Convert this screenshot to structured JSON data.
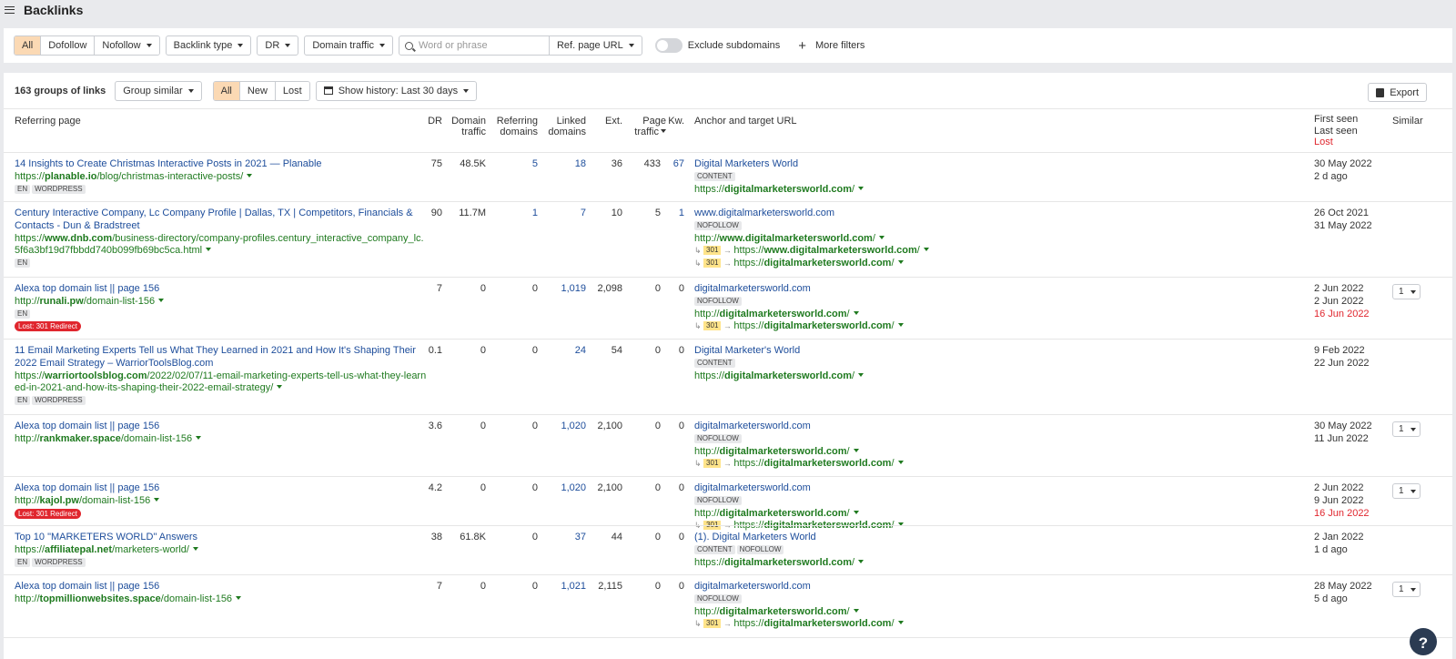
{
  "header": {
    "title": "Backlinks"
  },
  "filters": {
    "link_types": [
      "All",
      "Dofollow"
    ],
    "nofollow": "Nofollow",
    "backlink_type": "Backlink type",
    "dr": "DR",
    "domain_traffic": "Domain traffic",
    "search_placeholder": "Word or phrase",
    "search_scope": "Ref. page URL",
    "exclude_subdomains": "Exclude subdomains",
    "more_filters": "More filters"
  },
  "controls": {
    "count": "163 groups of links",
    "group": "Group similar",
    "status": [
      "All",
      "New",
      "Lost"
    ],
    "history": "Show history: Last 30 days",
    "export": "Export"
  },
  "columns": {
    "referring_page": "Referring page",
    "dr": "DR",
    "domain_traffic_1": "Domain",
    "domain_traffic_2": "traffic",
    "ref_domains_1": "Referring",
    "ref_domains_2": "domains",
    "linked_domains_1": "Linked",
    "linked_domains_2": "domains",
    "ext": "Ext.",
    "page_traffic_1": "Page",
    "page_traffic_2": "traffic",
    "kw": "Kw.",
    "anchor": "Anchor and target URL",
    "first_seen": "First seen",
    "last_seen": "Last seen",
    "lost": "Lost",
    "similar": "Similar"
  },
  "rows": [
    {
      "title": [
        "14 Insights to Create Christmas Interactive Posts in 2021 — Planable"
      ],
      "url": [
        {
          "pre": "https://",
          "bold": "planable.io",
          "post": "/blog/christmas-interactive-posts/"
        }
      ],
      "tags": [
        "EN",
        "WORDPRESS"
      ],
      "lost_badge": "",
      "dr": "75",
      "dt": "48.5K",
      "rd": "5",
      "ld": "18",
      "ext": "36",
      "pt": "433",
      "kw": "67",
      "anchor": "Digital Marketers World",
      "anchor_tags": [
        "CONTENT"
      ],
      "targets": [
        {
          "pre": "https://",
          "bold": "digitalmarketersworld.com",
          "post": "/"
        }
      ],
      "redirects": [],
      "first": "30 May 2022",
      "last": "2 d ago",
      "lost": "",
      "similar": ""
    },
    {
      "title": [
        "Century Interactive Company, Lc Company Profile | Dallas, TX | Competitors, Financials &",
        "Contacts - Dun & Bradstreet"
      ],
      "url": [
        {
          "pre": "https://",
          "bold": "www.dnb.com",
          "post": "/business-directory/company-profiles.century_interactive_company_lc."
        },
        {
          "pre": "",
          "bold": "",
          "post": "5f6a3bf19d7fbbdd740b099fb69bc5ca.html"
        }
      ],
      "tags": [
        "EN"
      ],
      "lost_badge": "",
      "dr": "90",
      "dt": "11.7M",
      "rd": "1",
      "ld": "7",
      "ext": "10",
      "pt": "5",
      "kw": "1",
      "anchor": "www.digitalmarketersworld.com",
      "anchor_tags": [
        "NOFOLLOW"
      ],
      "targets": [
        {
          "pre": "http://",
          "bold": "www.digitalmarketersworld.com",
          "post": "/"
        }
      ],
      "redirects": [
        {
          "code": "301",
          "pre": "https://",
          "bold": "www.digitalmarketersworld.com",
          "post": "/"
        },
        {
          "code": "301",
          "pre": "https://",
          "bold": "digitalmarketersworld.com",
          "post": "/"
        }
      ],
      "first": "26 Oct 2021",
      "last": "31 May 2022",
      "lost": "",
      "similar": ""
    },
    {
      "title": [
        "Alexa top domain list || page 156"
      ],
      "url": [
        {
          "pre": "http://",
          "bold": "runali.pw",
          "post": "/domain-list-156"
        }
      ],
      "tags": [
        "EN"
      ],
      "lost_badge": "Lost: 301 Redirect",
      "dr": "7",
      "dt": "0",
      "rd": "0",
      "ld": "1,019",
      "ext": "2,098",
      "pt": "0",
      "kw": "0",
      "anchor": "digitalmarketersworld.com",
      "anchor_tags": [
        "NOFOLLOW"
      ],
      "targets": [
        {
          "pre": "http://",
          "bold": "digitalmarketersworld.com",
          "post": "/"
        }
      ],
      "redirects": [
        {
          "code": "301",
          "pre": "https://",
          "bold": "digitalmarketersworld.com",
          "post": "/"
        }
      ],
      "first": "2 Jun 2022",
      "last": "2 Jun 2022",
      "lost": "16 Jun 2022",
      "similar": "1"
    },
    {
      "title": [
        "11 Email Marketing Experts Tell us What They Learned in 2021 and How It's Shaping Their",
        "2022 Email Strategy – WarriorToolsBlog.com"
      ],
      "url": [
        {
          "pre": "https://",
          "bold": "warriortoolsblog.com",
          "post": "/2022/02/07/11-email-marketing-experts-tell-us-what-they-learn"
        },
        {
          "pre": "",
          "bold": "",
          "post": "ed-in-2021-and-how-its-shaping-their-2022-email-strategy/"
        }
      ],
      "tags": [
        "EN",
        "WORDPRESS"
      ],
      "lost_badge": "",
      "dr": "0.1",
      "dt": "0",
      "rd": "0",
      "ld": "24",
      "ext": "54",
      "pt": "0",
      "kw": "0",
      "anchor": "Digital Marketer's World",
      "anchor_tags": [
        "CONTENT"
      ],
      "targets": [
        {
          "pre": "https://",
          "bold": "digitalmarketersworld.com",
          "post": "/"
        }
      ],
      "redirects": [],
      "first": "9 Feb 2022",
      "last": "22 Jun 2022",
      "lost": "",
      "similar": ""
    },
    {
      "title": [
        "Alexa top domain list || page 156"
      ],
      "url": [
        {
          "pre": "http://",
          "bold": "rankmaker.space",
          "post": "/domain-list-156"
        }
      ],
      "tags": [],
      "lost_badge": "",
      "dr": "3.6",
      "dt": "0",
      "rd": "0",
      "ld": "1,020",
      "ext": "2,100",
      "pt": "0",
      "kw": "0",
      "anchor": "digitalmarketersworld.com",
      "anchor_tags": [
        "NOFOLLOW"
      ],
      "targets": [
        {
          "pre": "http://",
          "bold": "digitalmarketersworld.com",
          "post": "/"
        }
      ],
      "redirects": [
        {
          "code": "301",
          "pre": "https://",
          "bold": "digitalmarketersworld.com",
          "post": "/"
        }
      ],
      "first": "30 May 2022",
      "last": "11 Jun 2022",
      "lost": "",
      "similar": "1"
    },
    {
      "title": [
        "Alexa top domain list || page 156"
      ],
      "url": [
        {
          "pre": "http://",
          "bold": "kajol.pw",
          "post": "/domain-list-156"
        }
      ],
      "tags": [],
      "lost_badge": "Lost: 301 Redirect",
      "dr": "4.2",
      "dt": "0",
      "rd": "0",
      "ld": "1,020",
      "ext": "2,100",
      "pt": "0",
      "kw": "0",
      "anchor": "digitalmarketersworld.com",
      "anchor_tags": [
        "NOFOLLOW"
      ],
      "targets": [
        {
          "pre": "http://",
          "bold": "digitalmarketersworld.com",
          "post": "/"
        }
      ],
      "redirects": [
        {
          "code": "301",
          "pre": "https://",
          "bold": "digitalmarketersworld.com",
          "post": "/"
        }
      ],
      "first": "2 Jun 2022",
      "last": "9 Jun 2022",
      "lost": "16 Jun 2022",
      "similar": "1"
    },
    {
      "title": [
        "Top 10 \"MARKETERS WORLD\" Answers"
      ],
      "url": [
        {
          "pre": "https://",
          "bold": "affiliatepal.net",
          "post": "/marketers-world/"
        }
      ],
      "tags": [
        "EN",
        "WORDPRESS"
      ],
      "lost_badge": "",
      "dr": "38",
      "dt": "61.8K",
      "rd": "0",
      "ld": "37",
      "ext": "44",
      "pt": "0",
      "kw": "0",
      "anchor": "(1). Digital Marketers World",
      "anchor_tags": [
        "CONTENT",
        "NOFOLLOW"
      ],
      "targets": [
        {
          "pre": "https://",
          "bold": "digitalmarketersworld.com",
          "post": "/"
        }
      ],
      "redirects": [],
      "first": "2 Jan 2022",
      "last": "1 d ago",
      "lost": "",
      "similar": ""
    },
    {
      "title": [
        "Alexa top domain list || page 156"
      ],
      "url": [
        {
          "pre": "http://",
          "bold": "topmillionwebsites.space",
          "post": "/domain-list-156"
        }
      ],
      "tags": [],
      "lost_badge": "",
      "dr": "7",
      "dt": "0",
      "rd": "0",
      "ld": "1,021",
      "ext": "2,115",
      "pt": "0",
      "kw": "0",
      "anchor": "digitalmarketersworld.com",
      "anchor_tags": [
        "NOFOLLOW"
      ],
      "targets": [
        {
          "pre": "http://",
          "bold": "digitalmarketersworld.com",
          "post": "/"
        }
      ],
      "redirects": [
        {
          "code": "301",
          "pre": "https://",
          "bold": "digitalmarketersworld.com",
          "post": "/"
        }
      ],
      "first": "28 May 2022",
      "last": "5 d ago",
      "lost": "",
      "similar": "1"
    }
  ],
  "help": {
    "label": "?"
  }
}
